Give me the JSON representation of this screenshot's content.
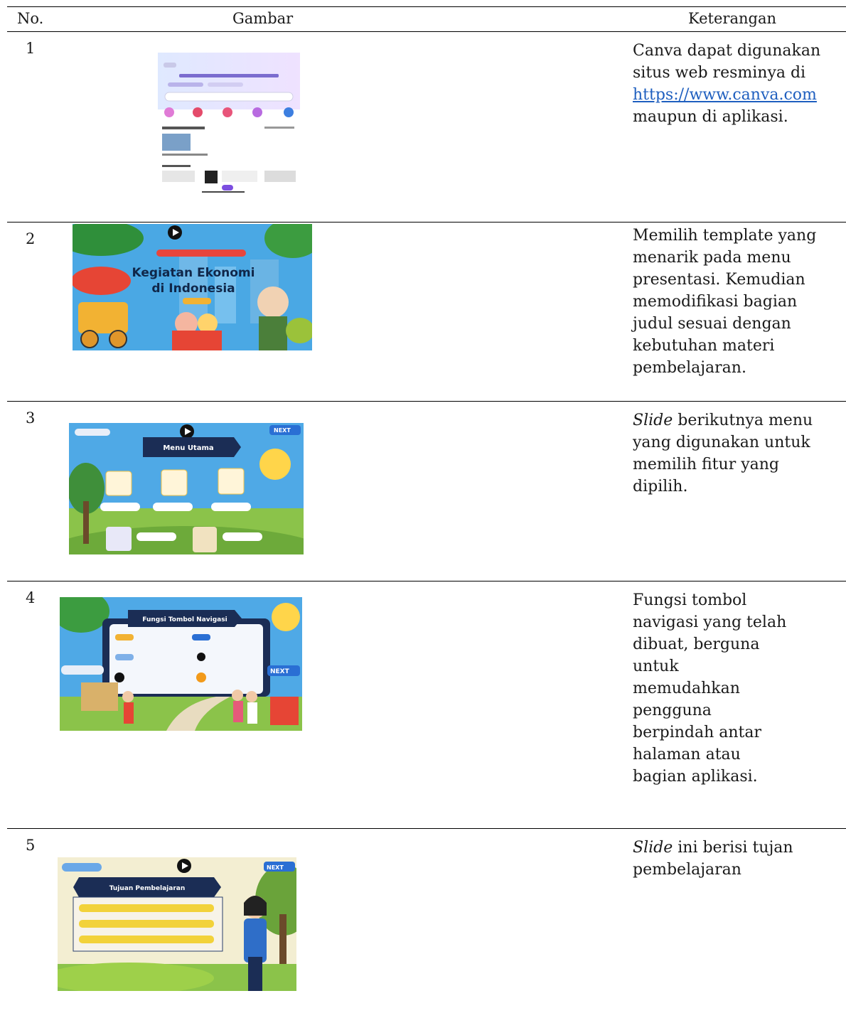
{
  "table": {
    "headers": {
      "no": "No.",
      "gambar": "Gambar",
      "keterangan": "Keterangan"
    },
    "rows": [
      {
        "no": "1",
        "description_lines": [
          "Canva dapat digunakan",
          "situs web resminya di"
        ],
        "link": "https://www.canva.com",
        "description_after": "maupun di aplikasi."
      },
      {
        "no": "2",
        "description_lines": [
          "Memilih template yang",
          "menarik pada menu",
          "presentasi. Kemudian",
          "memodifikasi bagian",
          "judul sesuai dengan",
          "kebutuhan materi",
          "pembelajaran."
        ],
        "image": {
          "title_line1": "Kegiatan Ekonomi",
          "title_line2": "di Indonesia"
        }
      },
      {
        "no": "3",
        "desc_italic": "Slide",
        "description_lines": [
          " berikutnya menu",
          "yang digunakan untuk",
          "memilih fitur yang",
          "dipilih."
        ],
        "image": {
          "banner": "Menu Utama",
          "next": "NEXT"
        }
      },
      {
        "no": "4",
        "description_lines": [
          "Fungsi tombol",
          "navigasi yang telah",
          "dibuat, berguna",
          "untuk",
          "memudahkan",
          "pengguna",
          "berpindah antar",
          "halaman atau",
          "bagian aplikasi."
        ],
        "image": {
          "banner": "Fungsi Tombol Navigasi",
          "next": "NEXT"
        }
      },
      {
        "no": "5",
        "desc_italic": "Slide",
        "description_lines": [
          " ini berisi tujan",
          "pembelajaran"
        ],
        "image": {
          "banner": "Tujuan Pembelajaran",
          "next": "NEXT"
        }
      }
    ]
  },
  "colors": {
    "rule": "#000000",
    "link": "#1f5fbf",
    "sky": "#4fa9e6",
    "banner": "#1b2d55"
  }
}
